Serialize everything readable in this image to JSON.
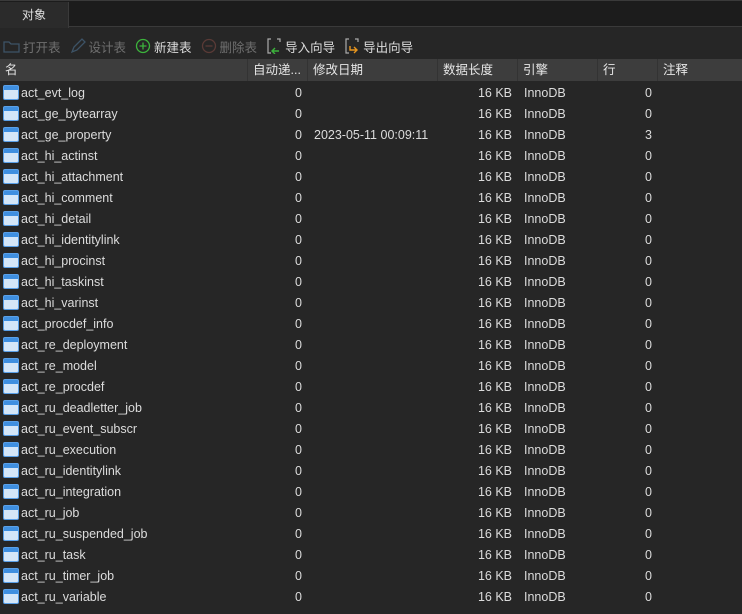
{
  "tab": "对象",
  "toolbar": {
    "open": "打开表",
    "design": "设计表",
    "new": "新建表",
    "delete": "删除表",
    "import": "导入向导",
    "export": "导出向导"
  },
  "columns": [
    "名",
    "自动递...",
    "修改日期",
    "数据长度",
    "引擎",
    "行",
    "注释"
  ],
  "rows": [
    [
      "act_evt_log",
      "0",
      "",
      "16 KB",
      "InnoDB",
      "0",
      ""
    ],
    [
      "act_ge_bytearray",
      "0",
      "",
      "16 KB",
      "InnoDB",
      "0",
      ""
    ],
    [
      "act_ge_property",
      "0",
      "2023-05-11 00:09:11",
      "16 KB",
      "InnoDB",
      "3",
      ""
    ],
    [
      "act_hi_actinst",
      "0",
      "",
      "16 KB",
      "InnoDB",
      "0",
      ""
    ],
    [
      "act_hi_attachment",
      "0",
      "",
      "16 KB",
      "InnoDB",
      "0",
      ""
    ],
    [
      "act_hi_comment",
      "0",
      "",
      "16 KB",
      "InnoDB",
      "0",
      ""
    ],
    [
      "act_hi_detail",
      "0",
      "",
      "16 KB",
      "InnoDB",
      "0",
      ""
    ],
    [
      "act_hi_identitylink",
      "0",
      "",
      "16 KB",
      "InnoDB",
      "0",
      ""
    ],
    [
      "act_hi_procinst",
      "0",
      "",
      "16 KB",
      "InnoDB",
      "0",
      ""
    ],
    [
      "act_hi_taskinst",
      "0",
      "",
      "16 KB",
      "InnoDB",
      "0",
      ""
    ],
    [
      "act_hi_varinst",
      "0",
      "",
      "16 KB",
      "InnoDB",
      "0",
      ""
    ],
    [
      "act_procdef_info",
      "0",
      "",
      "16 KB",
      "InnoDB",
      "0",
      ""
    ],
    [
      "act_re_deployment",
      "0",
      "",
      "16 KB",
      "InnoDB",
      "0",
      ""
    ],
    [
      "act_re_model",
      "0",
      "",
      "16 KB",
      "InnoDB",
      "0",
      ""
    ],
    [
      "act_re_procdef",
      "0",
      "",
      "16 KB",
      "InnoDB",
      "0",
      ""
    ],
    [
      "act_ru_deadletter_job",
      "0",
      "",
      "16 KB",
      "InnoDB",
      "0",
      ""
    ],
    [
      "act_ru_event_subscr",
      "0",
      "",
      "16 KB",
      "InnoDB",
      "0",
      ""
    ],
    [
      "act_ru_execution",
      "0",
      "",
      "16 KB",
      "InnoDB",
      "0",
      ""
    ],
    [
      "act_ru_identitylink",
      "0",
      "",
      "16 KB",
      "InnoDB",
      "0",
      ""
    ],
    [
      "act_ru_integration",
      "0",
      "",
      "16 KB",
      "InnoDB",
      "0",
      ""
    ],
    [
      "act_ru_job",
      "0",
      "",
      "16 KB",
      "InnoDB",
      "0",
      ""
    ],
    [
      "act_ru_suspended_job",
      "0",
      "",
      "16 KB",
      "InnoDB",
      "0",
      ""
    ],
    [
      "act_ru_task",
      "0",
      "",
      "16 KB",
      "InnoDB",
      "0",
      ""
    ],
    [
      "act_ru_timer_job",
      "0",
      "",
      "16 KB",
      "InnoDB",
      "0",
      ""
    ],
    [
      "act_ru_variable",
      "0",
      "",
      "16 KB",
      "InnoDB",
      "0",
      ""
    ]
  ]
}
